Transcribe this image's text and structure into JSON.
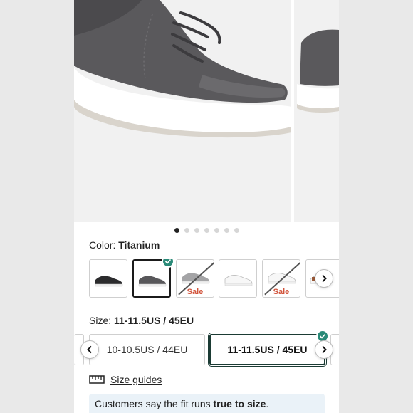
{
  "gallery": {
    "dots_total": 7,
    "active_dot": 0
  },
  "color": {
    "label": "Color:",
    "value": "Titanium"
  },
  "swatches": [
    {
      "name": "black",
      "sale": false
    },
    {
      "name": "titanium",
      "sale": false,
      "selected": true
    },
    {
      "name": "grey",
      "sale": true,
      "sale_label": "Sale"
    },
    {
      "name": "white",
      "sale": false
    },
    {
      "name": "white-2",
      "sale": true,
      "sale_label": "Sale"
    },
    {
      "name": "white-brown",
      "sale": false
    }
  ],
  "size": {
    "label": "Size:",
    "value": "11-11.5US / 45EU",
    "options": [
      "10-10.5US / 44EU",
      "11-11.5US / 45EU"
    ],
    "selected_index": 1
  },
  "size_guide": {
    "label": "Size guides"
  },
  "fit": {
    "prefix": "Customers say the fit runs ",
    "emphasis": "true to size",
    "suffix": "."
  },
  "colors": {
    "accent": "#2a8a78",
    "sale": "#d2553d",
    "fit_bg": "#eaf2f8"
  }
}
